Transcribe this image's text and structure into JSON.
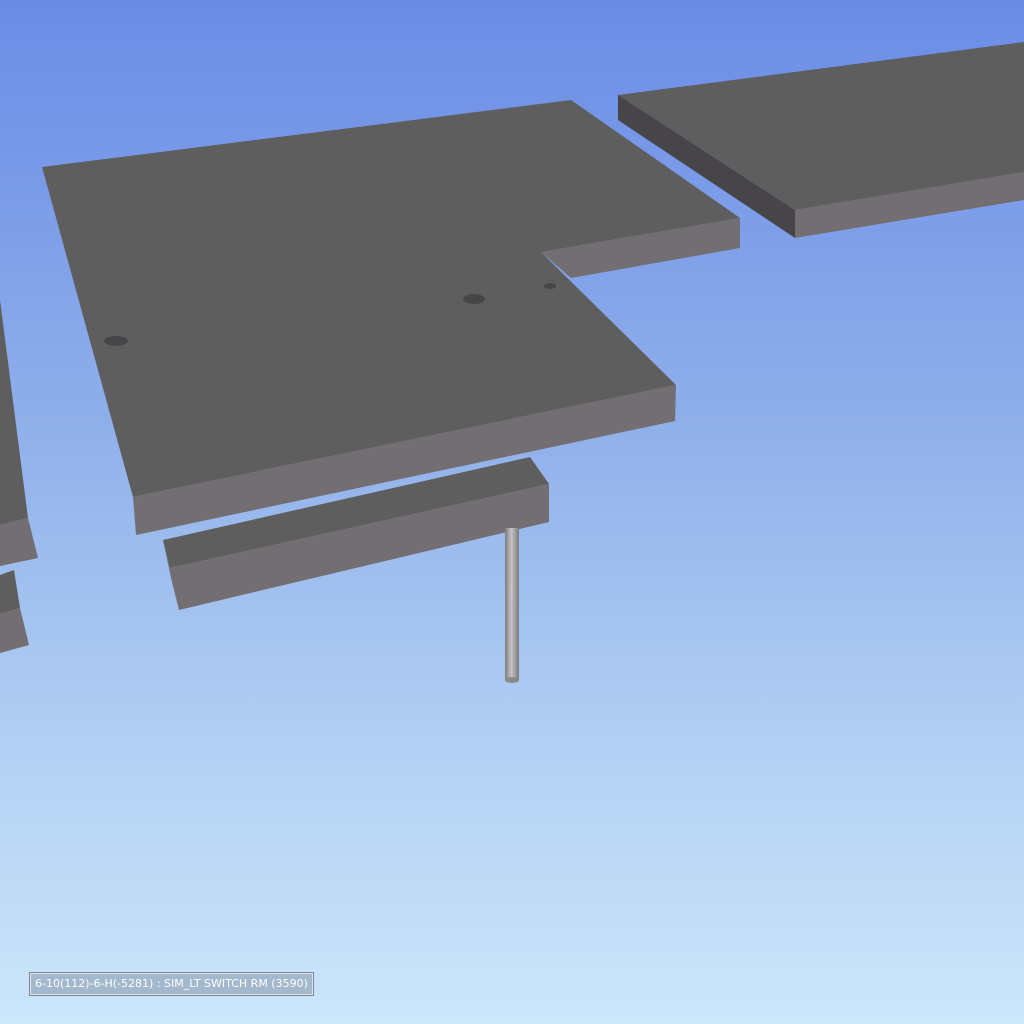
{
  "viewport": {
    "background_top": "#6a8ce6",
    "background_bottom": "#cce6fa",
    "object_top_color": "#5f5e5e",
    "object_side_color": "#736e71",
    "object_dark_side_color": "#474548",
    "pipe_color": "#9a9a9a"
  },
  "status": {
    "label": "6-10(112)-6-H(-5281) : SIM_LT SWITCH RM (3590)"
  }
}
